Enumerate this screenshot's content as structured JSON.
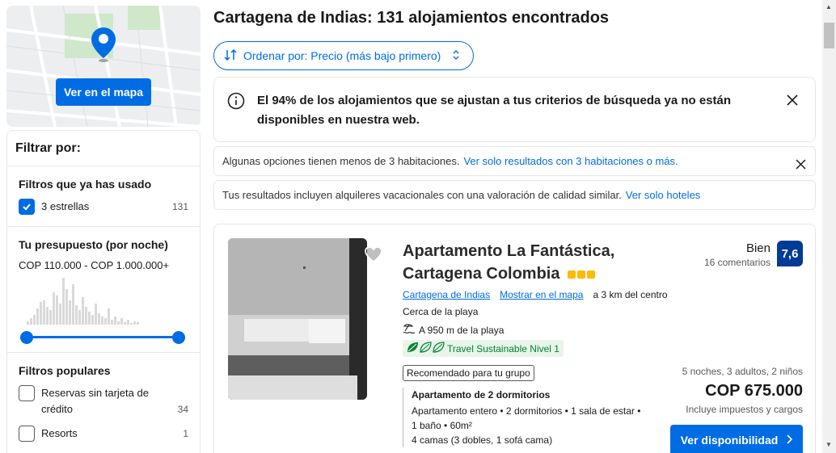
{
  "map": {
    "button_label": "Ver en el mapa",
    "pin_icon": "map-pin-icon"
  },
  "filters": {
    "title": "Filtrar por:",
    "used": {
      "heading": "Filtros que ya has usado",
      "items": [
        {
          "label": "3 estrellas",
          "count": "131",
          "checked": true
        }
      ]
    },
    "budget": {
      "heading": "Tu presupuesto (por noche)",
      "range": "COP 110.000 - COP 1.000.000+"
    },
    "popular": {
      "heading": "Filtros populares",
      "items": [
        {
          "label": "Reservas sin tarjeta de crédito",
          "count": "34"
        },
        {
          "label": "Resorts",
          "count": "1"
        }
      ]
    }
  },
  "main": {
    "title": "Cartagena de Indias: 131 alojamientos encontrados",
    "sort_label": "Ordenar por: Precio (más bajo primero)",
    "notice": "El 94% de los alojamientos que se ajustan a tus criterios de búsqueda ya no están disponibles en nuestra web.",
    "bar1": {
      "text": "Algunas opciones tienen menos de 3 habitaciones.",
      "link": "Ver solo resultados con 3 habitaciones o más."
    },
    "bar2": {
      "text": "Tus resultados incluyen alquileres vacacionales con una valoración de calidad similar.",
      "link": "Ver solo hoteles"
    }
  },
  "property": {
    "name": "Apartamento La Fantástica, Cartagena Colombia",
    "stars": 3,
    "score_word": "Bien",
    "reviews": "16 comentarios",
    "score": "7,6",
    "location_link": "Cartagena de Indias",
    "map_link": "Mostrar en el mapa",
    "distance": "a 3 km del centro",
    "beach": "Cerca de la playa",
    "beach_distance": "A 950 m de la playa",
    "sustainable": "Travel Sustainable Nivel 1",
    "recommended": "Recomendado para tu grupo",
    "room_title": "Apartamento de 2 dormitorios",
    "room_details": "Apartamento entero • 2 dormitorios • 1 sala de estar • 1 baño • 60m²",
    "beds": "4 camas (3 dobles, 1 sofá cama)",
    "stay": "5 noches, 3 adultos, 2 niños",
    "price": "COP 675.000",
    "tax": "Incluye impuestos y cargos",
    "button": "Ver disponibilidad"
  },
  "colors": {
    "accent": "#006ce4",
    "score_bg": "#003b95",
    "star": "#febb02",
    "sustainable": "#008234"
  }
}
